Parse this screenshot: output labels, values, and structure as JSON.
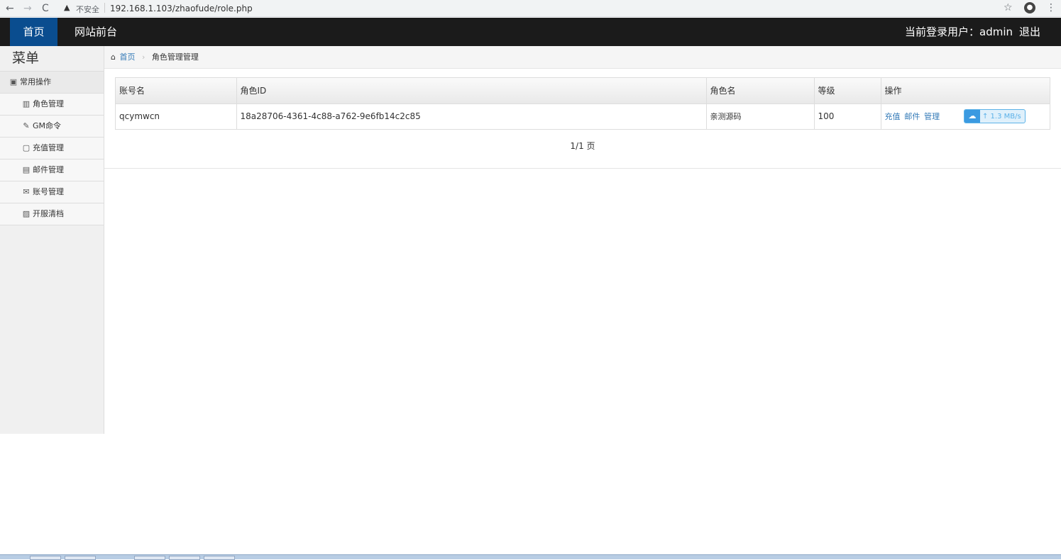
{
  "browser": {
    "insecure_label": "不安全",
    "url": "192.168.1.103/zhaofude/role.php"
  },
  "navbar": {
    "home": "首页",
    "front": "网站前台",
    "current_user": "当前登录用户：admin",
    "logout": "退出"
  },
  "sidebar": {
    "title": "菜单",
    "group": "常用操作",
    "items": [
      {
        "label": "角色管理",
        "icon": "users-icon"
      },
      {
        "label": "GM命令",
        "icon": "wrench-icon"
      },
      {
        "label": "充值管理",
        "icon": "file-icon"
      },
      {
        "label": "邮件管理",
        "icon": "list-icon"
      },
      {
        "label": "账号管理",
        "icon": "envelope-icon"
      },
      {
        "label": "开服清档",
        "icon": "picture-icon"
      }
    ]
  },
  "breadcrumb": {
    "home": "首页",
    "current": "角色管理管理"
  },
  "table": {
    "headers": [
      "账号名",
      "角色ID",
      "角色名",
      "等级",
      "操作"
    ],
    "rows": [
      {
        "account": "qcymwcn",
        "role_id": "18a28706-4361-4c88-a762-9e6fb14c2c85",
        "role_name": "亲测源码",
        "level": "100",
        "actions": [
          "充值",
          "邮件",
          "管理"
        ]
      }
    ]
  },
  "speed_badge": "↑ 1.3 MB/s",
  "pager": "1/1 页"
}
